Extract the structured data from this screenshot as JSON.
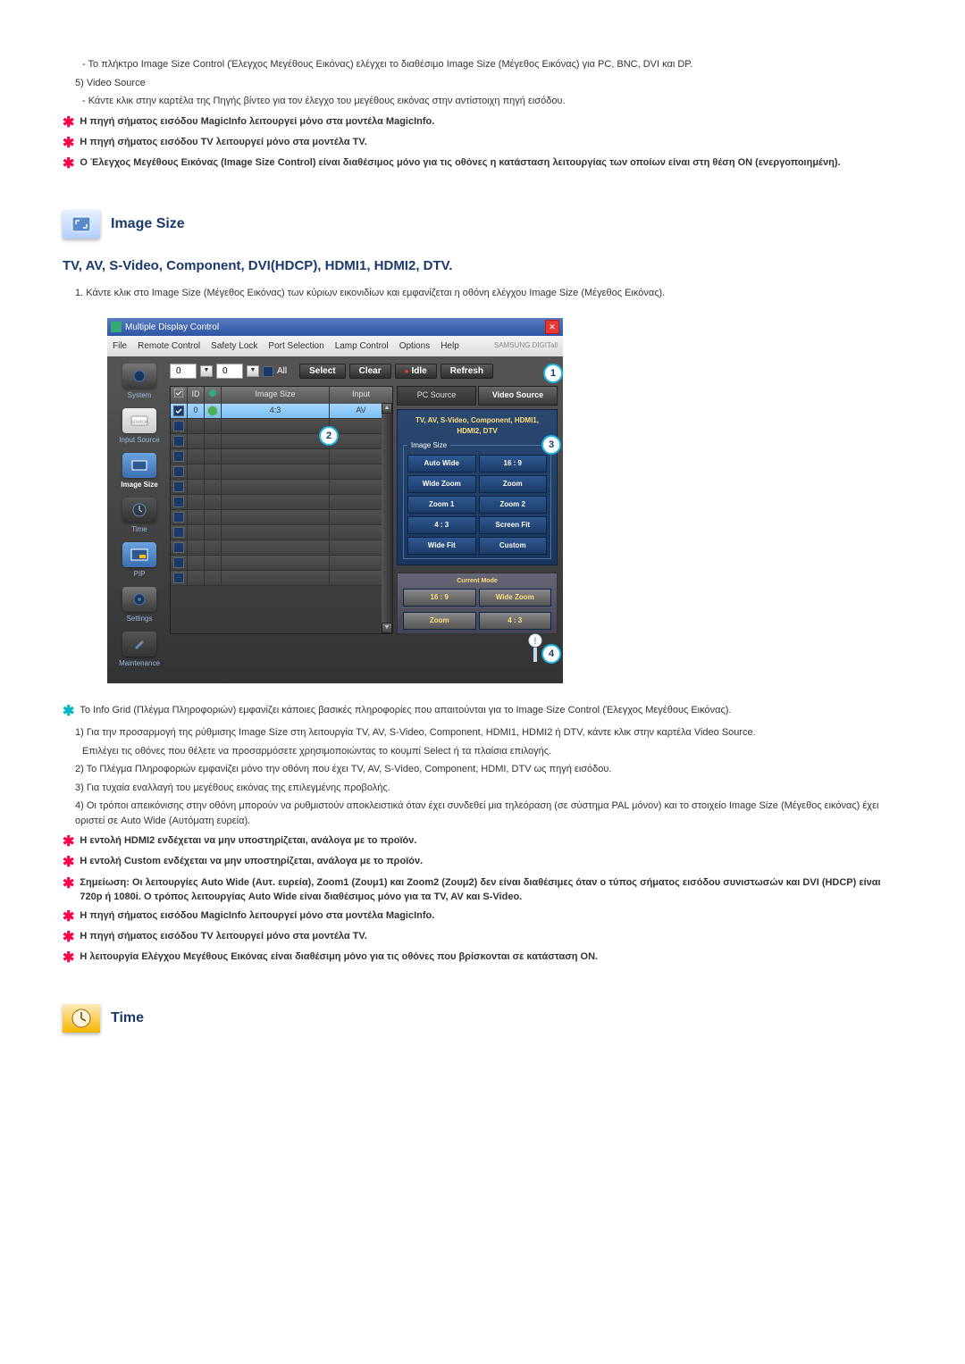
{
  "intro": {
    "line1": "- Το πλήκτρο Image Size Control (Έλεγχος Μεγέθους Εικόνας) ελέγχει το διαθέσιμο Image Size (Μέγεθος Εικόνας) για PC, BNC, DVI και DP.",
    "item5": "5)  Video Source",
    "item5desc": "- Κάντε κλικ στην καρτέλα της Πηγής βίντεο για τον έλεγχο του μεγέθους εικόνας στην αντίστοιχη πηγή εισόδου.",
    "note1": "Η πηγή σήματος εισόδου MagicInfo λειτουργεί μόνο στα μοντέλα MagicInfo.",
    "note2": "Η πηγή σήματος εισόδου TV λειτουργεί μόνο στα μοντέλα TV.",
    "note3": "Ο Έλεγχος Μεγέθους Εικόνας (Image Size Control) είναι διαθέσιμος μόνο για τις οθόνες η κατάσταση λειτουργίας των οποίων είναι στη θέση ON (ενεργοποιημένη)."
  },
  "section_image_size": "Image Size",
  "subtitle": "TV, AV, S-Video, Component, DVI(HDCP), HDMI1, HDMI2, DTV.",
  "step1": "1.  Κάντε κλικ στο Image Size (Μέγεθος Εικόνας) των κύριων εικονιδίων και εμφανίζεται η οθόνη ελέγχου Image Size (Μέγεθος Εικόνας).",
  "app": {
    "title": "Multiple Display Control",
    "menu": {
      "file": "File",
      "remote": "Remote Control",
      "safety": "Safety Lock",
      "port": "Port Selection",
      "lamp": "Lamp Control",
      "options": "Options",
      "help": "Help",
      "brand": "SAMSUNG DIGITall"
    },
    "toolbar": {
      "val1": "0",
      "val2": "0",
      "all": "All",
      "select": "Select",
      "clear": "Clear",
      "idle": "Idle",
      "refresh": "Refresh"
    },
    "sidebar": {
      "system": "System",
      "input": "Input Source",
      "image": "Image Size",
      "time": "Time",
      "pip": "PIP",
      "settings": "Settings",
      "maint": "Maintenance"
    },
    "grid": {
      "h_id": "ID",
      "h_size": "Image Size",
      "h_input": "Input",
      "r1_id": "0",
      "r1_size": "4:3",
      "r1_input": "AV"
    },
    "right": {
      "tab_pc": "PC Source",
      "tab_vid": "Video Source",
      "header": "TV, AV, S-Video, Component, HDMI1, HDMI2, DTV",
      "legend": "Image Size",
      "b_auto": "Auto Wide",
      "b_169": "16 : 9",
      "b_wz": "Wide Zoom",
      "b_zoom": "Zoom",
      "b_z1": "Zoom 1",
      "b_z2": "Zoom 2",
      "b_43": "4 : 3",
      "b_fit": "Screen Fit",
      "b_wf": "Wide Fit",
      "b_custom": "Custom",
      "panel2_hdr": "Current Mode",
      "p2_169": "16 : 9",
      "p2_wz": "Wide Zoom",
      "p2_zoom": "Zoom",
      "p2_43": "4 : 3"
    },
    "callouts": {
      "c1": "1",
      "c2": "2",
      "c3": "3",
      "c4": "4"
    }
  },
  "after": {
    "info": "Το Info Grid (Πλέγμα Πληροφοριών) εμφανίζει κάποιες βασικές πληροφορίες που απαιτούνται για το Image Size Control (Έλεγχος Μεγέθους Εικόνας).",
    "i1a": "1)  Για την προσαρμογή της ρύθμισης Image Size στη λειτουργία TV, AV, S-Video, Component, HDMI1, HDMI2 ή DTV, κάντε κλικ στην καρτέλα Video Source.",
    "i1b": "Επιλέγει τις οθόνες που θέλετε να προσαρμόσετε χρησιμοποιώντας το κουμπί Select ή τα πλαίσια επιλογής.",
    "i2": "2)  Το Πλέγμα Πληροφοριών εμφανίζει μόνο την οθόνη που έχει TV, AV, S-Video, Component, HDMI, DTV ως πηγή εισόδου.",
    "i3": "3)  Για τυχαία εναλλαγή του μεγέθους εικόνας της επιλεγμένης προβολής.",
    "i4": "4)  Οι τρόποι απεικόνισης στην οθόνη μπορούν να ρυθμιστούν αποκλειστικά όταν έχει συνδεθεί μια τηλεόραση (σε σύστημα PAL μόνον) και το στοιχείο Image Size (Μέγεθος εικόνας) έχει οριστεί σε Auto Wide (Αυτόματη ευρεία).",
    "n1": "Η εντολή HDMI2 ενδέχεται να μην υποστηρίζεται, ανάλογα με το προϊόν.",
    "n2": "Η εντολή Custom ενδέχεται να μην υποστηρίζεται, ανάλογα με το προϊόν.",
    "n3": "Σημείωση: Οι λειτουργίες Auto Wide (Αυτ. ευρεία), Zoom1 (Ζουμ1) και Zoom2 (Ζουμ2) δεν είναι διαθέσιμες όταν ο τύπος σήματος εισόδου συνιστωσών και DVI (HDCP) είναι 720p ή 1080i. Ο τρόπος λειτουργίας Auto Wide είναι διαθέσιμος μόνο για τα TV, AV και S-Video.",
    "n4": "Η πηγή σήματος εισόδου MagicInfo λειτουργεί μόνο στα μοντέλα MagicInfo.",
    "n5": "Η πηγή σήματος εισόδου TV λειτουργεί μόνο στα μοντέλα TV.",
    "n6": "Η λειτουργία Ελέγχου Μεγέθους Εικόνας είναι διαθέσιμη μόνο για τις οθόνες που βρίσκονται σε κατάσταση ON."
  },
  "section_time": "Time"
}
